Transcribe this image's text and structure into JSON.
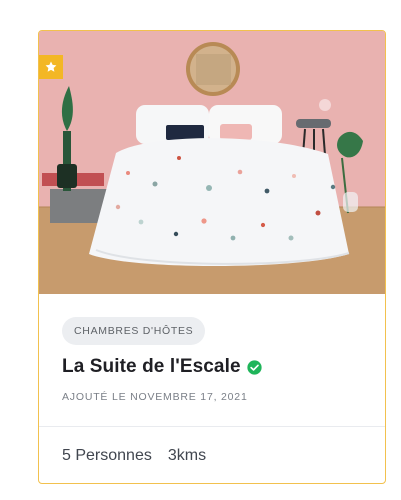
{
  "listing": {
    "featured_icon": "star-icon",
    "category": "CHAMBRES D'HÔTES",
    "title": "La Suite de l'Escale",
    "verified_icon": "check-circle-icon",
    "date": "AJOUTÉ LE NOVEMBRE 17, 2021",
    "capacity": "5 Personnes",
    "distance": "3kms"
  },
  "colors": {
    "card_border": "#f2c14e",
    "featured_badge": "#f3b725",
    "verified": "#1fb55a",
    "wall": "#e9b2b0",
    "floor": "#c79b6d"
  }
}
